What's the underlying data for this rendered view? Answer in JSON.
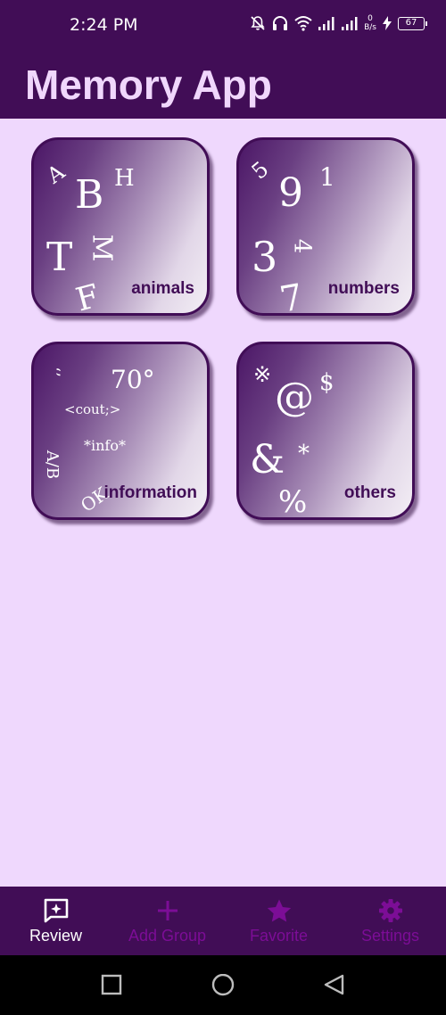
{
  "status_bar": {
    "time": "2:24 PM",
    "net_speed_value": "0",
    "net_speed_unit": "B/s",
    "battery": "67"
  },
  "app_bar": {
    "title": "Memory App"
  },
  "tiles": [
    {
      "label": "animals",
      "glyphs": [
        "A",
        "B",
        "H",
        "T",
        "M",
        "F"
      ]
    },
    {
      "label": "numbers",
      "glyphs": [
        "5",
        "9",
        "1",
        "3",
        "4",
        "7"
      ]
    },
    {
      "label": "information",
      "glyphs": [
        "‘’",
        "70°",
        "<cout;>",
        "*info*",
        "A/B",
        "OK"
      ]
    },
    {
      "label": "others",
      "glyphs": [
        "※",
        "@",
        "$",
        "&",
        "*",
        "%"
      ]
    }
  ],
  "bottom_nav": [
    {
      "label": "Review",
      "icon": "review-icon",
      "active": true
    },
    {
      "label": "Add Group",
      "icon": "plus-icon",
      "active": false
    },
    {
      "label": "Favorite",
      "icon": "star-icon",
      "active": false
    },
    {
      "label": "Settings",
      "icon": "gear-icon",
      "active": false
    }
  ],
  "colors": {
    "primary": "#410d56",
    "background": "#efd8fd",
    "title": "#f0d7fc",
    "inactive_nav": "#7c0d96"
  }
}
